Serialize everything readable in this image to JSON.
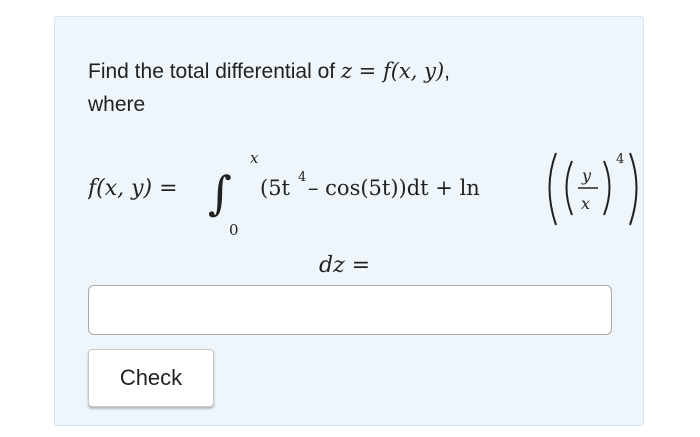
{
  "question": {
    "prefix": "Find the total differential of ",
    "z_expr": "z = f(x, y)",
    "suffix": ",",
    "line2": "where"
  },
  "formula": {
    "lhs": "f(x, y) =",
    "integral_sign": "∫",
    "upper_limit": "x",
    "lower_limit": "0",
    "integrand_part1": "(5t",
    "integrand_exp": "4",
    "integrand_part2": " – cos(5t))dt + ln",
    "frac_num": "y",
    "frac_den": "x",
    "outer_exp": "4"
  },
  "answer": {
    "label": "dz =",
    "value": ""
  },
  "check_button": {
    "label": "Check"
  }
}
